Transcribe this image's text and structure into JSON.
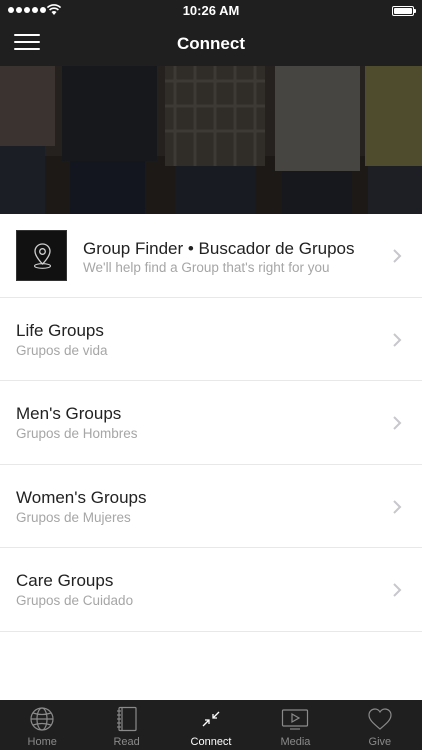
{
  "status": {
    "time": "10:26 AM"
  },
  "navbar": {
    "title": "Connect"
  },
  "list": [
    {
      "title": "Group Finder • Buscador de Grupos",
      "subtitle": "We'll help find a Group that's right for you"
    },
    {
      "title": "Life Groups",
      "subtitle": "Grupos de vida"
    },
    {
      "title": "Men's Groups",
      "subtitle": "Grupos de Hombres"
    },
    {
      "title": "Women's Groups",
      "subtitle": "Grupos de Mujeres"
    },
    {
      "title": "Care Groups",
      "subtitle": "Grupos de Cuidado"
    }
  ],
  "tabs": [
    {
      "label": "Home",
      "icon": "globe-icon",
      "active": false
    },
    {
      "label": "Read",
      "icon": "notebook-icon",
      "active": false
    },
    {
      "label": "Connect",
      "icon": "connect-arrows-icon",
      "active": true
    },
    {
      "label": "Media",
      "icon": "play-screen-icon",
      "active": false
    },
    {
      "label": "Give",
      "icon": "heart-icon",
      "active": false
    }
  ],
  "colors": {
    "bar": "#1f1f1f",
    "active_tab": "#ffffff",
    "inactive_tab": "#8a8a8a",
    "subtitle": "#a6a6a6"
  }
}
